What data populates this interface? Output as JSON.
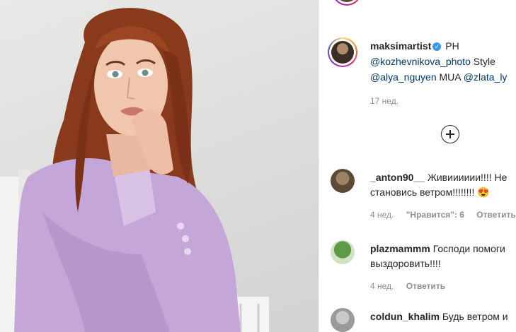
{
  "post": {
    "author": "maksimartist",
    "caption_prefix": "PH",
    "photographer": "@kozhevnikova_photo",
    "style_label": "Style",
    "stylist": "@alya_nguyen",
    "mua_label": "MUA",
    "mua": "@zlata_ly",
    "time": "17 нед."
  },
  "comments": [
    {
      "user": "_anton90__",
      "line1": "Живииииии!!!! Не",
      "line2": "становись ветром!!!!!!!!",
      "emoji": "😍",
      "time": "4 нед.",
      "likes": "\"Нравится\": 6",
      "reply": "Ответить"
    },
    {
      "user": "plazmammm",
      "line1": "Господи помоги",
      "line2": "выздоровить!!!!",
      "time": "4 нед.",
      "reply": "Ответить"
    },
    {
      "user": "coldun_khalim",
      "line1": "Будь ветром и"
    }
  ],
  "icons": {
    "verified": "verified-badge-icon",
    "load_more": "plus-circle-icon"
  },
  "colors": {
    "link": "#00376b",
    "meta": "#8e8e8e",
    "verified": "#3897f0",
    "suit": "#c4a6d8",
    "hair": "#8a3a1c"
  }
}
